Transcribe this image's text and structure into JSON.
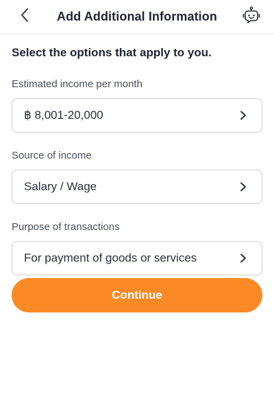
{
  "header": {
    "title": "Add Additional Information",
    "back_icon": "chevron-left-icon",
    "assistant_icon": "chatbot-icon"
  },
  "main": {
    "heading": "Select the options that apply to you.",
    "fields": [
      {
        "label": "Estimated income per month",
        "value": "฿ 8,001-20,000"
      },
      {
        "label": "Source of income",
        "value": "Salary / Wage"
      },
      {
        "label": "Purpose of transactions",
        "value": "For payment of goods or services"
      }
    ],
    "continue_label": "Continue"
  },
  "colors": {
    "accent": "#fb8a26",
    "text": "#1f2430",
    "border": "#c9ccd2"
  }
}
